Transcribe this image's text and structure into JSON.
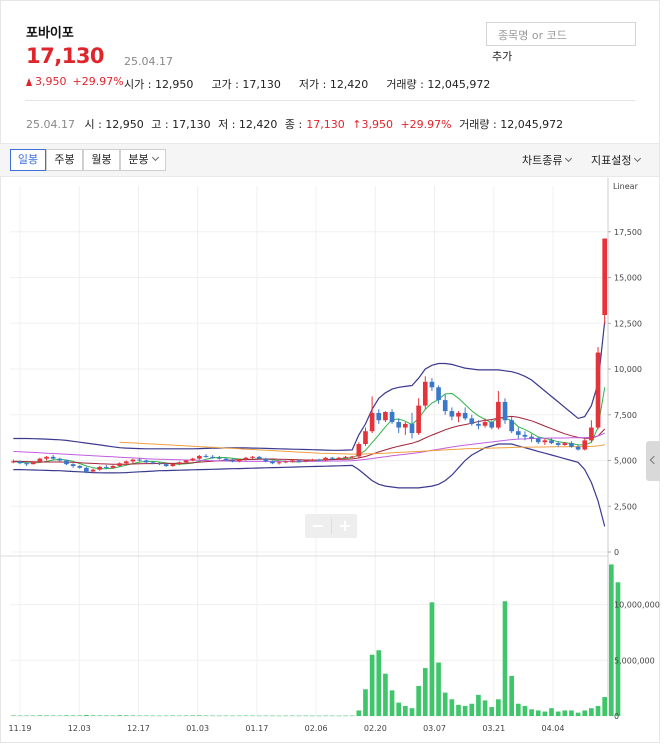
{
  "header": {
    "stock_name": "포바이포",
    "price": "17,130",
    "price_date": "25.04.17",
    "change_amount": "3,950",
    "change_pct": "+29.97%",
    "open_label": "시가 : 12,950",
    "high_label": "고가 : 17,130",
    "low_label": "저가 : 12,420",
    "volume_label": "거래량 : 12,045,972",
    "up_color": "#e0242b"
  },
  "search": {
    "placeholder": "종목명 or 코드",
    "add_label": "추가"
  },
  "ohlc_line": {
    "date": "25.04.17",
    "open": "시 : 12,950",
    "high": "고 : 17,130",
    "low": "저 : 12,420",
    "close_label": "종 :",
    "close_value": "17,130",
    "change": "↑3,950",
    "pct": "+29.97%",
    "volume": "거래량 : 12,045,972"
  },
  "toolbar": {
    "daily": "일봉",
    "weekly": "주봉",
    "monthly": "월봉",
    "minute": "분봉",
    "chart_type": "차트종류",
    "indicator": "지표설정",
    "active_tab": "일봉"
  },
  "zoom": {
    "minus": "−",
    "plus": "+"
  },
  "chart_data": {
    "type": "candlestick",
    "scale_label": "Linear",
    "x_ticks": [
      "11.19",
      "12.03",
      "12.17",
      "01.03",
      "01.17",
      "02.06",
      "02.20",
      "03.07",
      "03.21",
      "04.04"
    ],
    "price_ticks": [
      "17,500",
      "15,000",
      "12,500",
      "10,000",
      "7,500",
      "5,000",
      "2,500",
      "0"
    ],
    "price_tick_values": [
      17500,
      15000,
      12500,
      10000,
      7500,
      5000,
      2500,
      0
    ],
    "price_range": [
      0,
      20000
    ],
    "volume_ticks": [
      "10,000,000",
      "5,000,000",
      "0"
    ],
    "volume_tick_values": [
      10000000,
      5000000,
      0
    ],
    "volume_range": [
      0,
      14000000
    ],
    "colors": {
      "up": "#e5333b",
      "down": "#3a78c9",
      "volume": "#3fc56a",
      "ma5": "#2fb34a",
      "ma20": "#a3223a",
      "ma60": "#c25ee0",
      "ma120": "#f0a040",
      "bollinger": "#3a3a8f"
    },
    "candles": [
      [
        4900,
        5050,
        4850,
        4950
      ],
      [
        4950,
        5000,
        4800,
        4850
      ],
      [
        4850,
        4900,
        4700,
        4800
      ],
      [
        4800,
        4950,
        4780,
        4900
      ],
      [
        4900,
        5150,
        4880,
        5100
      ],
      [
        5100,
        5250,
        5000,
        5200
      ],
      [
        5200,
        5300,
        5050,
        5100
      ],
      [
        5100,
        5150,
        4950,
        5000
      ],
      [
        5000,
        5050,
        4750,
        4800
      ],
      [
        4800,
        4850,
        4600,
        4700
      ],
      [
        4700,
        4750,
        4550,
        4600
      ],
      [
        4600,
        4650,
        4300,
        4400
      ],
      [
        4400,
        4550,
        4300,
        4500
      ],
      [
        4500,
        4700,
        4450,
        4650
      ],
      [
        4650,
        4750,
        4550,
        4600
      ],
      [
        4600,
        4750,
        4550,
        4700
      ],
      [
        4700,
        4900,
        4650,
        4850
      ],
      [
        4850,
        5000,
        4750,
        4950
      ],
      [
        4950,
        5100,
        4850,
        5050
      ],
      [
        5050,
        5150,
        4950,
        5000
      ],
      [
        5000,
        5050,
        4850,
        4900
      ],
      [
        4900,
        4950,
        4800,
        4850
      ],
      [
        4850,
        4900,
        4750,
        4800
      ],
      [
        4800,
        4850,
        4650,
        4700
      ],
      [
        4700,
        4850,
        4650,
        4800
      ],
      [
        4800,
        4950,
        4750,
        4900
      ],
      [
        4900,
        5050,
        4850,
        5000
      ],
      [
        5000,
        5150,
        4950,
        5100
      ],
      [
        5100,
        5300,
        5050,
        5250
      ],
      [
        5250,
        5350,
        5150,
        5200
      ],
      [
        5200,
        5300,
        5100,
        5150
      ],
      [
        5150,
        5250,
        5050,
        5100
      ],
      [
        5100,
        5150,
        4950,
        5000
      ],
      [
        5000,
        5100,
        4900,
        4950
      ],
      [
        4950,
        5100,
        4900,
        5050
      ],
      [
        5050,
        5200,
        5000,
        5150
      ],
      [
        5150,
        5250,
        5100,
        5200
      ],
      [
        5200,
        5250,
        5050,
        5100
      ],
      [
        5100,
        5150,
        4900,
        4950
      ],
      [
        4950,
        5000,
        4800,
        4850
      ],
      [
        4850,
        4950,
        4780,
        4900
      ],
      [
        4900,
        5000,
        4850,
        4950
      ],
      [
        4950,
        5050,
        4880,
        5000
      ],
      [
        5000,
        5050,
        4900,
        4950
      ],
      [
        4950,
        5050,
        4900,
        5000
      ],
      [
        5000,
        5100,
        4950,
        5050
      ],
      [
        5050,
        5100,
        4950,
        5000
      ],
      [
        5000,
        5200,
        4950,
        5150
      ],
      [
        5150,
        5200,
        5050,
        5100
      ],
      [
        5100,
        5200,
        5050,
        5150
      ],
      [
        5150,
        5250,
        5100,
        5200
      ],
      [
        5200,
        5250,
        5150,
        5220
      ],
      [
        5220,
        6000,
        5100,
        5900
      ],
      [
        5900,
        6800,
        5800,
        6600
      ],
      [
        6600,
        8500,
        6500,
        7600
      ],
      [
        7600,
        7800,
        7000,
        7200
      ],
      [
        7200,
        7700,
        7100,
        7650
      ],
      [
        7650,
        7800,
        7000,
        7100
      ],
      [
        7100,
        7300,
        6500,
        6800
      ],
      [
        6800,
        7100,
        6400,
        7000
      ],
      [
        7000,
        7600,
        6200,
        6500
      ],
      [
        6500,
        8400,
        6400,
        8000
      ],
      [
        8000,
        9600,
        7800,
        9300
      ],
      [
        9300,
        9500,
        8800,
        9000
      ],
      [
        9000,
        9100,
        8100,
        8300
      ],
      [
        8300,
        8600,
        7500,
        7700
      ],
      [
        7700,
        7900,
        7200,
        7400
      ],
      [
        7400,
        7700,
        7100,
        7600
      ],
      [
        7600,
        7900,
        7200,
        7300
      ],
      [
        7300,
        7500,
        6900,
        7000
      ],
      [
        7000,
        7200,
        6700,
        6900
      ],
      [
        6900,
        7300,
        6800,
        7100
      ],
      [
        7100,
        7200,
        6700,
        6800
      ],
      [
        6800,
        8800,
        6700,
        8200
      ],
      [
        8200,
        8400,
        7000,
        7200
      ],
      [
        7200,
        7400,
        6500,
        6600
      ],
      [
        6600,
        6800,
        6200,
        6400
      ],
      [
        6400,
        6600,
        6100,
        6300
      ],
      [
        6300,
        6450,
        6000,
        6200
      ],
      [
        6200,
        6300,
        5900,
        6000
      ],
      [
        6000,
        6200,
        5850,
        6100
      ],
      [
        6100,
        6200,
        5900,
        5950
      ],
      [
        5950,
        6050,
        5750,
        5850
      ],
      [
        5850,
        6000,
        5800,
        5950
      ],
      [
        5950,
        6050,
        5700,
        5750
      ],
      [
        5750,
        5850,
        5550,
        5600
      ],
      [
        5600,
        6200,
        5550,
        6100
      ],
      [
        6100,
        7200,
        6000,
        6800
      ],
      [
        6800,
        11200,
        6700,
        10900
      ],
      [
        12950,
        17130,
        12420,
        17130
      ]
    ],
    "volume": [
      50000,
      40000,
      45000,
      40000,
      60000,
      55000,
      50000,
      45000,
      60000,
      55000,
      50000,
      90000,
      60000,
      55000,
      50000,
      45000,
      70000,
      60000,
      50000,
      40000,
      45000,
      40000,
      35000,
      40000,
      45000,
      40000,
      50000,
      55000,
      60000,
      45000,
      40000,
      35000,
      40000,
      35000,
      40000,
      45000,
      40000,
      35000,
      40000,
      35000,
      30000,
      35000,
      40000,
      35000,
      40000,
      35000,
      30000,
      40000,
      35000,
      30000,
      35000,
      40000,
      500000,
      2400000,
      5500000,
      5900000,
      3800000,
      2300000,
      1200000,
      900000,
      700000,
      2700000,
      4300000,
      10200000,
      4800000,
      2100000,
      1500000,
      1000000,
      900000,
      1100000,
      1900000,
      1400000,
      800000,
      1500000,
      10300000,
      3600000,
      1100000,
      900000,
      600000,
      500000,
      400000,
      700000,
      400000,
      500000,
      500000,
      300000,
      500000,
      700000,
      900000,
      1700000,
      13600000,
      12000000
    ],
    "series": [
      {
        "name": "ma5",
        "values": [
          4930,
          4910,
          4880,
          4870,
          4890,
          4950,
          5030,
          5060,
          5030,
          4950,
          4830,
          4700,
          4600,
          4560,
          4550,
          4580,
          4660,
          4750,
          4830,
          4910,
          4950,
          4950,
          4920,
          4870,
          4810,
          4800,
          4820,
          4860,
          4960,
          5070,
          5140,
          5170,
          5160,
          5120,
          5080,
          5060,
          5070,
          5090,
          5080,
          5050,
          4990,
          4950,
          4930,
          4920,
          4960,
          4990,
          5000,
          5040,
          5060,
          5090,
          5130,
          5160,
          5310,
          5560,
          5970,
          6400,
          6840,
          7230,
          7270,
          7150,
          6960,
          7300,
          7800,
          8140,
          8340,
          8640,
          8660,
          8400,
          8060,
          7710,
          7440,
          7240,
          7060,
          7340,
          7300,
          7180,
          6840,
          6700,
          6500,
          6290,
          6210,
          6130,
          6020,
          5980,
          5930,
          5850,
          5850,
          5990,
          6810,
          9000
        ]
      },
      {
        "name": "ma20",
        "values": [
          4960,
          4950,
          4940,
          4930,
          4920,
          4920,
          4920,
          4920,
          4910,
          4900,
          4880,
          4860,
          4840,
          4820,
          4810,
          4800,
          4800,
          4800,
          4810,
          4820,
          4830,
          4830,
          4840,
          4840,
          4840,
          4850,
          4860,
          4880,
          4910,
          4940,
          4960,
          4990,
          5010,
          5030,
          5040,
          5050,
          5060,
          5070,
          5080,
          5080,
          5070,
          5060,
          5050,
          5040,
          5030,
          5030,
          5030,
          5040,
          5050,
          5060,
          5070,
          5080,
          5140,
          5220,
          5340,
          5470,
          5580,
          5690,
          5780,
          5860,
          5940,
          6060,
          6230,
          6390,
          6530,
          6680,
          6800,
          6890,
          6960,
          7040,
          7130,
          7190,
          7240,
          7310,
          7370,
          7410,
          7360,
          7270,
          7170,
          7030,
          6880,
          6740,
          6590,
          6460,
          6350,
          6260,
          6220,
          6220,
          6340,
          6720
        ]
      },
      {
        "name": "ma60",
        "values": [
          5500,
          5480,
          5460,
          5440,
          5420,
          5400,
          5380,
          5360,
          5340,
          5320,
          5300,
          5280,
          5260,
          5240,
          5220,
          5200,
          5180,
          5160,
          5140,
          5120,
          5100,
          5080,
          5070,
          5060,
          5050,
          5040,
          5030,
          5020,
          5010,
          5000,
          4990,
          4980,
          4970,
          4960,
          4960,
          4950,
          4950,
          4950,
          4950,
          4950,
          4950,
          4950,
          4950,
          4950,
          4950,
          4950,
          4960,
          4960,
          4970,
          4970,
          4980,
          4990,
          5020,
          5060,
          5110,
          5160,
          5210,
          5260,
          5300,
          5340,
          5380,
          5430,
          5490,
          5560,
          5620,
          5680,
          5740,
          5790,
          5840,
          5880,
          5930,
          5970,
          6010,
          6060,
          6100,
          6140,
          6170,
          6180,
          6200,
          6210,
          6220,
          6230,
          6230,
          6230,
          6240,
          6240,
          6250,
          6270,
          6340,
          6490
        ]
      },
      {
        "name": "ma120",
        "values": [
          null,
          null,
          null,
          null,
          null,
          null,
          null,
          null,
          null,
          null,
          null,
          null,
          null,
          null,
          null,
          null,
          6000,
          5980,
          5960,
          5940,
          5920,
          5900,
          5880,
          5860,
          5840,
          5820,
          5800,
          5780,
          5760,
          5740,
          5720,
          5700,
          5680,
          5660,
          5640,
          5620,
          5600,
          5580,
          5560,
          5540,
          5520,
          5500,
          5480,
          5460,
          5440,
          5420,
          5400,
          5390,
          5380,
          5370,
          5360,
          5350,
          5350,
          5360,
          5370,
          5380,
          5400,
          5420,
          5440,
          5460,
          5480,
          5500,
          5520,
          5540,
          5560,
          5580,
          5600,
          5620,
          5640,
          5650,
          5660,
          5670,
          5680,
          5690,
          5700,
          5710,
          5720,
          5730,
          5730,
          5740,
          5740,
          5750,
          5750,
          5750,
          5760,
          5760,
          5760,
          5770,
          5800,
          5860
        ]
      },
      {
        "name": "bb_upper",
        "values": [
          6200,
          6200,
          6200,
          6190,
          6180,
          6170,
          6150,
          6130,
          6100,
          6050,
          6000,
          5950,
          5900,
          5850,
          5800,
          5750,
          5700,
          5680,
          5660,
          5650,
          5640,
          5640,
          5640,
          5640,
          5640,
          5640,
          5640,
          5640,
          5650,
          5660,
          5670,
          5680,
          5690,
          5690,
          5690,
          5690,
          5680,
          5670,
          5660,
          5650,
          5640,
          5630,
          5620,
          5610,
          5600,
          5590,
          5580,
          5570,
          5560,
          5560,
          5570,
          5580,
          6400,
          7000,
          7800,
          8400,
          8700,
          8900,
          9000,
          9050,
          9100,
          9500,
          10000,
          10200,
          10300,
          10300,
          10250,
          10150,
          10050,
          10000,
          9950,
          9950,
          9950,
          9950,
          9900,
          9850,
          9750,
          9600,
          9400,
          9100,
          8800,
          8500,
          8200,
          7900,
          7600,
          7300,
          7400,
          8000,
          9200,
          12600
        ]
      },
      {
        "name": "bb_lower",
        "values": [
          4500,
          4500,
          4490,
          4480,
          4470,
          4460,
          4450,
          4440,
          4420,
          4400,
          4380,
          4360,
          4340,
          4330,
          4320,
          4320,
          4330,
          4340,
          4360,
          4380,
          4400,
          4420,
          4440,
          4450,
          4460,
          4470,
          4480,
          4490,
          4500,
          4510,
          4520,
          4530,
          4540,
          4550,
          4560,
          4570,
          4580,
          4590,
          4600,
          4610,
          4620,
          4630,
          4640,
          4650,
          4660,
          4670,
          4680,
          4690,
          4700,
          4710,
          4720,
          4730,
          4500,
          4200,
          3900,
          3700,
          3600,
          3550,
          3500,
          3500,
          3500,
          3500,
          3550,
          3600,
          3700,
          3900,
          4200,
          4600,
          5000,
          5300,
          5500,
          5700,
          5800,
          5900,
          5900,
          5900,
          5800,
          5700,
          5600,
          5500,
          5400,
          5300,
          5200,
          5100,
          5000,
          4900,
          4500,
          3800,
          2800,
          1400
        ]
      }
    ]
  }
}
